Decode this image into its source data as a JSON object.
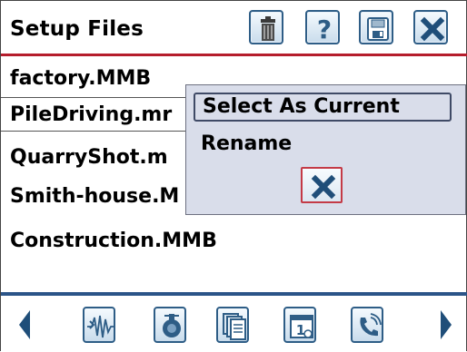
{
  "header": {
    "title": "Setup Files",
    "toolbar": [
      {
        "icon": "trash-icon"
      },
      {
        "icon": "help-icon"
      },
      {
        "icon": "save-icon"
      },
      {
        "icon": "close-icon"
      }
    ]
  },
  "files": [
    {
      "label": "factory.MMB"
    },
    {
      "label": "PileDriving.mr"
    },
    {
      "label": "QuarryShot.m"
    },
    {
      "label": "Smith-house.M"
    },
    {
      "label": "Construction.MMB"
    }
  ],
  "context_menu": {
    "items": [
      {
        "label": "Select As Current"
      },
      {
        "label": "Rename"
      }
    ],
    "close_icon": "close-icon"
  },
  "bottom_bar": {
    "icons": [
      "scroll-left-icon",
      "waveform-icon",
      "sensor-icon",
      "documents-icon",
      "calendar-icon",
      "phone-icon",
      "scroll-right-icon"
    ]
  },
  "colors": {
    "accent_red": "#b51d2c",
    "nav_blue": "#2b5488",
    "popup_bg": "#d9ddea"
  }
}
